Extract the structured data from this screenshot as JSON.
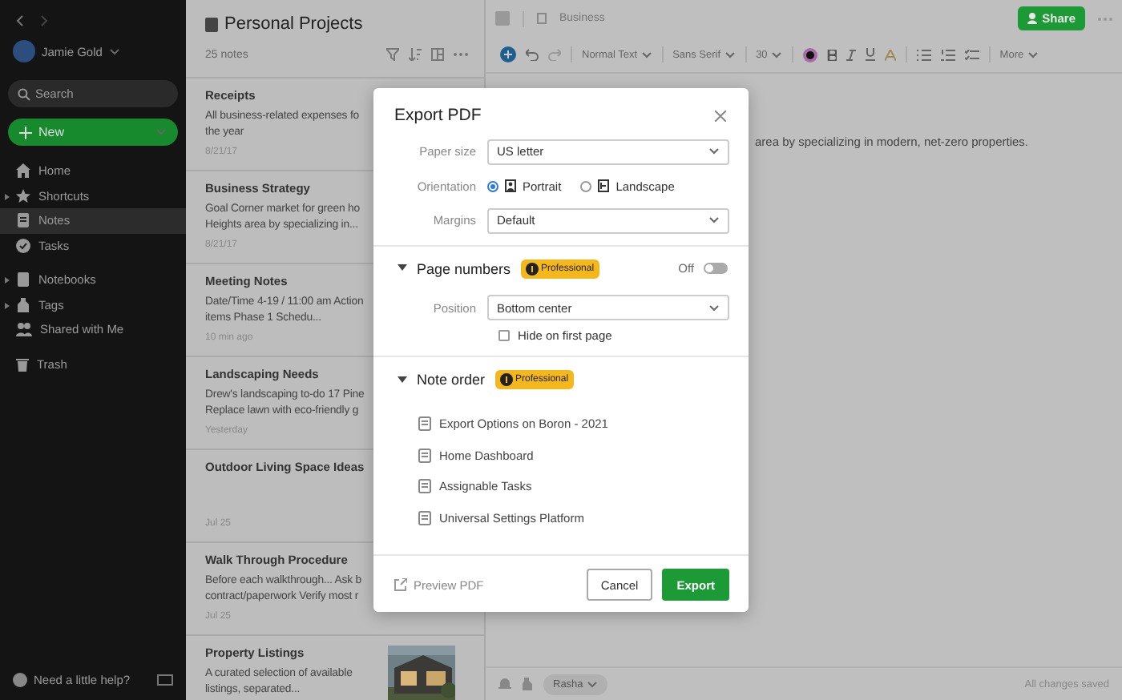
{
  "sidebar": {
    "user": "Jamie Gold",
    "search": {
      "placeholder": "Search"
    },
    "new_button": "New",
    "items": [
      {
        "label": "Home",
        "kind": "link",
        "selected": false
      },
      {
        "label": "Shortcuts",
        "kind": "group",
        "selected": false
      },
      {
        "label": "Notes",
        "kind": "link",
        "selected": true
      },
      {
        "label": "Tasks",
        "kind": "link",
        "selected": false
      },
      {
        "label": "Notebooks",
        "kind": "group",
        "selected": false
      },
      {
        "label": "Tags",
        "kind": "group",
        "selected": false
      },
      {
        "label": "Shared with Me",
        "kind": "link",
        "selected": false
      },
      {
        "label": "Trash",
        "kind": "link",
        "selected": false
      }
    ],
    "help": "Need a little help?"
  },
  "note_list": {
    "title": "Personal Projects",
    "count": "25 notes",
    "notes": [
      {
        "title": "Receipts",
        "lines": [
          "All business-related expenses fo",
          "the year"
        ],
        "date": "8/21/17"
      },
      {
        "title": "Business Strategy",
        "lines": [
          "Goal Corner market for green ho",
          "Heights area by specializing in..."
        ],
        "date": "8/21/17"
      },
      {
        "title": "Meeting Notes",
        "lines": [
          "Date/Time 4-19 / 11:00 am Action",
          "items Phase 1 Schedu..."
        ],
        "date": "10 min ago"
      },
      {
        "title": "Landscaping Needs",
        "lines": [
          "Drew's landscaping to-do 17 Pine",
          "Replace lawn with eco-friendly g"
        ],
        "date": "Yesterday"
      },
      {
        "title": "Outdoor Living Space Ideas",
        "date": "Jul 25"
      },
      {
        "title": "Walk Through Procedure",
        "lines": [
          "Before each walkthrough... Ask b",
          "contract/paperwork Verify most r"
        ],
        "date": "Jul 25"
      },
      {
        "title": "Property Listings",
        "lines": [
          "A curated selection of available",
          "listings, separated..."
        ],
        "kind": "picture"
      }
    ]
  },
  "editor": {
    "notebook": "Business",
    "share": "Share",
    "toolbar": {
      "style": "Normal Text",
      "font": "Sans Serif",
      "size": "30",
      "more": "More"
    },
    "body_text": "area by specializing in modern, net-zero properties.",
    "owner": "Rasha",
    "status": "All changes saved"
  },
  "dialog": {
    "title": "Export PDF",
    "paper_size": {
      "label": "Paper size",
      "value": "US letter"
    },
    "orientation": {
      "label": "Orientation",
      "options": [
        {
          "label": "Portrait",
          "selected": true
        },
        {
          "label": "Landscape",
          "selected": false
        }
      ]
    },
    "margins": {
      "label": "Margins",
      "value": "Default"
    },
    "page_numbers": {
      "title": "Page numbers",
      "badge": "Professional",
      "toggle_label": "Off",
      "on": false,
      "position": {
        "label": "Position",
        "value": "Bottom center"
      },
      "hide_first": {
        "label": "Hide on first page",
        "checked": false
      }
    },
    "note_order": {
      "title": "Note order",
      "badge": "Professional",
      "notes": [
        "Export Options on Boron - 2021",
        "Home Dashboard",
        "Assignable Tasks",
        "Universal Settings Platform"
      ]
    },
    "preview": "Preview PDF",
    "cancel": "Cancel",
    "export": "Export"
  }
}
